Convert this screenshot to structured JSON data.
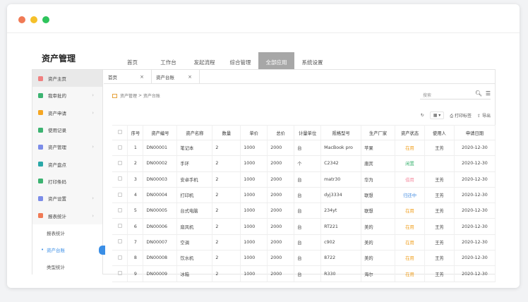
{
  "window": {
    "dots": [
      "#f07a55",
      "#f5c02a",
      "#2ec45c"
    ]
  },
  "app": {
    "title": "资产管理"
  },
  "topnav": [
    {
      "label": "首页",
      "active": false
    },
    {
      "label": "工作台",
      "active": false
    },
    {
      "label": "发起流程",
      "active": false
    },
    {
      "label": "综合管理",
      "active": false
    },
    {
      "label": "全部应用",
      "active": true
    },
    {
      "label": "系统设置",
      "active": false
    }
  ],
  "sidebar": {
    "items": [
      {
        "label": "资产主页",
        "icon": "home-icon",
        "color": "#f08080",
        "chev": false
      },
      {
        "label": "我审批的",
        "icon": "approve-icon",
        "color": "#3cb371",
        "chev": true
      },
      {
        "label": "资产申请",
        "icon": "apply-icon",
        "color": "#f5a623",
        "chev": true
      },
      {
        "label": "使用记录",
        "icon": "record-icon",
        "color": "#3cb371",
        "chev": false
      },
      {
        "label": "资产管理",
        "icon": "manage-icon",
        "color": "#7b8ce8",
        "chev": true
      },
      {
        "label": "资产盘点",
        "icon": "inventory-icon",
        "color": "#2aa8a8",
        "chev": false
      },
      {
        "label": "打印条码",
        "icon": "barcode-icon",
        "color": "#3cb371",
        "chev": false
      },
      {
        "label": "资产设置",
        "icon": "settings-icon",
        "color": "#7b8ce8",
        "chev": true
      },
      {
        "label": "报表统计",
        "icon": "report-icon",
        "color": "#f07a55",
        "chev": true
      }
    ],
    "subs": [
      {
        "label": "报表统计",
        "active": false
      },
      {
        "label": "资产台账",
        "active": true
      },
      {
        "label": "类型统计",
        "active": false
      }
    ]
  },
  "tabs": [
    {
      "label": "首页",
      "active": false
    },
    {
      "label": "资产台账",
      "active": true
    }
  ],
  "close_glyph": "×",
  "breadcrumb": {
    "root": "资产管理",
    "sep": ">",
    "current": "资产台账"
  },
  "search": {
    "placeholder": "搜索"
  },
  "toolbar": {
    "refresh": "↻",
    "columns": "▦ ▾",
    "print": "打印标签",
    "export": "导出"
  },
  "table": {
    "headers": [
      "",
      "序号",
      "资产编号",
      "资产名称",
      "数量",
      "单价",
      "总价",
      "计量单位",
      "规格型号",
      "生产厂家",
      "资产状态",
      "使用人",
      "申请日期"
    ],
    "rows": [
      [
        "1",
        "DN00001",
        "笔记本",
        "2",
        "1000",
        "2000",
        "台",
        "MacBook pro",
        "苹果",
        "在用",
        "王芳",
        "2020-12-30"
      ],
      [
        "2",
        "DN00002",
        "手环",
        "2",
        "1000",
        "2000",
        "个",
        "C2342",
        "唐宾",
        "闲置",
        "",
        "2020-12-30"
      ],
      [
        "3",
        "DN00003",
        "安卓手机",
        "2",
        "1000",
        "2000",
        "台",
        "matr30",
        "华为",
        "借用",
        "王芳",
        "2020-12-30"
      ],
      [
        "4",
        "DN00004",
        "打印机",
        "2",
        "1000",
        "2000",
        "台",
        "dyj3334",
        "联想",
        "归还中",
        "王芳",
        "2020-12-30"
      ],
      [
        "5",
        "DN00005",
        "台式电脑",
        "2",
        "1000",
        "2000",
        "台",
        "234yt",
        "联想",
        "在用",
        "王芳",
        "2020-12-30"
      ],
      [
        "6",
        "DN00006",
        "扇风机",
        "2",
        "1000",
        "2000",
        "台",
        "RT221",
        "美的",
        "在用",
        "王芳",
        "2020-12-30"
      ],
      [
        "7",
        "DN00007",
        "空调",
        "2",
        "1000",
        "2000",
        "台",
        "c902",
        "美的",
        "在用",
        "王芳",
        "2020-12-30"
      ],
      [
        "8",
        "DN00008",
        "饮水机",
        "2",
        "1000",
        "2000",
        "台",
        "8722",
        "美的",
        "在用",
        "王芳",
        "2020-12-30"
      ],
      [
        "9",
        "DN00009",
        "冰箱",
        "2",
        "1000",
        "2000",
        "台",
        "R330",
        "海尔",
        "在用",
        "王芳",
        "2020-12-30"
      ]
    ],
    "status_colors": {
      "在用": "st-orange",
      "闲置": "st-green",
      "借用": "st-pink",
      "归还中": "st-blue"
    }
  }
}
